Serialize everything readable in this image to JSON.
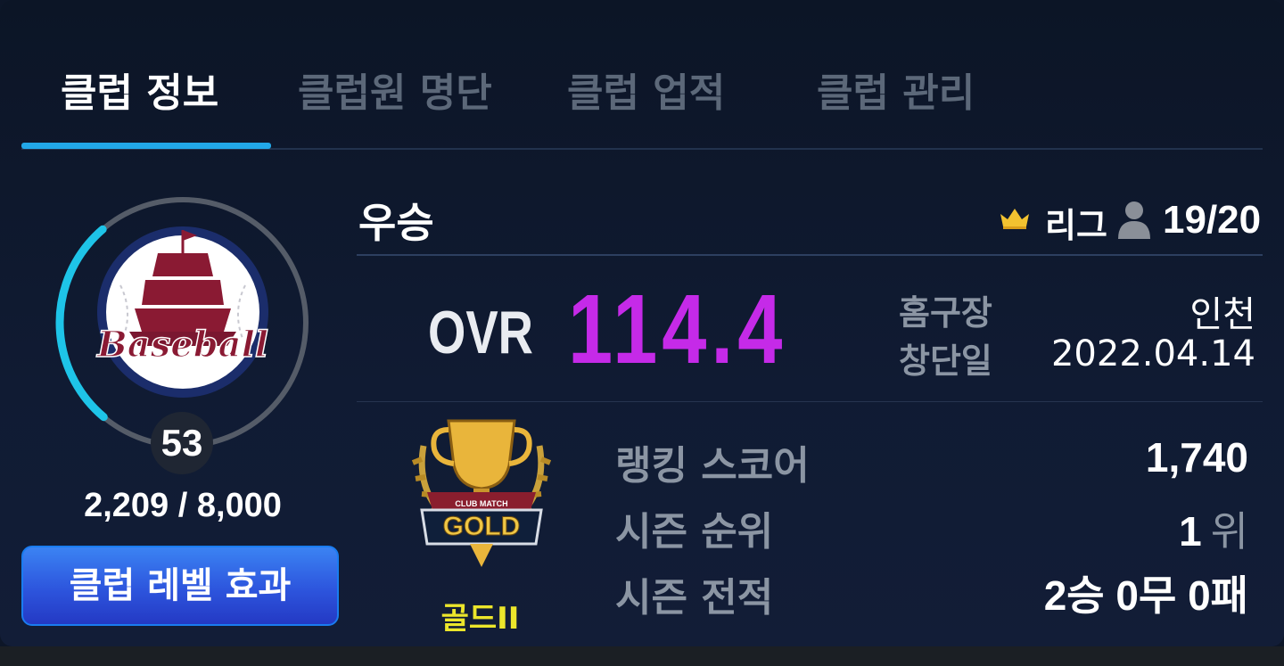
{
  "tabs": [
    {
      "label": "클럽 정보",
      "active": true
    },
    {
      "label": "클럽원 명단",
      "active": false
    },
    {
      "label": "클럽 업적",
      "active": false
    },
    {
      "label": "클럽 관리",
      "active": false
    }
  ],
  "club": {
    "name": "우승",
    "league_label": "리그",
    "members": "19/20",
    "logo_text": "Baseball",
    "level": "53",
    "exp": "2,209 / 8,000",
    "exp_progress": 0.276,
    "level_effect_button": "클럽 레벨 효과"
  },
  "ovr": {
    "label": "OVR",
    "value": "114.4"
  },
  "info": {
    "home_label": "홈구장",
    "home_value": "인천",
    "founded_label": "창단일",
    "founded_value": "2022.04.14"
  },
  "rank": {
    "emblem_title": "GOLD",
    "emblem_subtitle": "CLUB MATCH",
    "tier": "골드II",
    "score_label": "랭킹 스코어",
    "score_value": "1,740",
    "season_rank_label": "시즌 순위",
    "season_rank_value": "1",
    "season_rank_unit": "위",
    "season_record_label": "시즌 전적",
    "season_record_value": "2승 0무 0패"
  },
  "colors": {
    "accent": "#22a8e8",
    "ovr": "#c52ae8",
    "tier": "#ece62b",
    "button": "#2d55dd"
  }
}
